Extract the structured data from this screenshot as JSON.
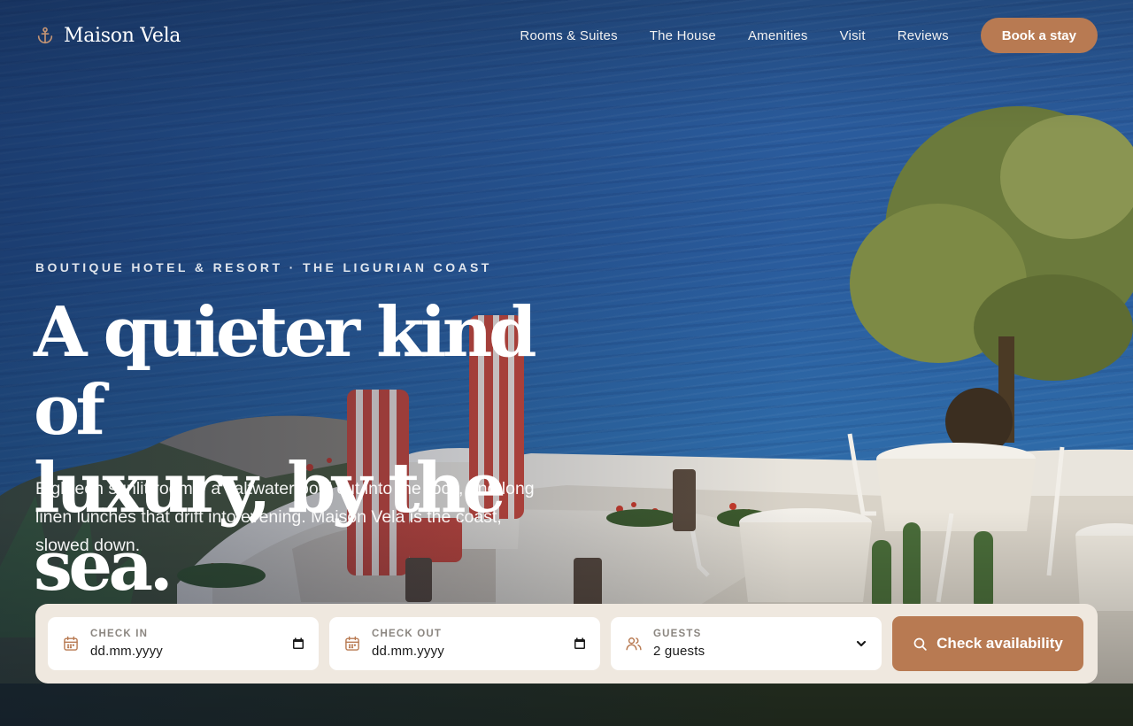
{
  "brand": {
    "name": "Maison Vela",
    "icon": "anchor-icon"
  },
  "nav": {
    "links": [
      "Rooms & Suites",
      "The House",
      "Amenities",
      "Visit",
      "Reviews"
    ],
    "cta": "Book a stay"
  },
  "hero": {
    "eyebrow": "BOUTIQUE HOTEL & RESORT · THE LIGURIAN COAST",
    "headline_line1": "A quieter kind of",
    "headline_line2": "luxury, by the sea.",
    "lede": "Eighteen sunlit rooms, a saltwater pool cut into the rock, and long linen lunches that drift into evening. Maison Vela is the coast, slowed down."
  },
  "booking": {
    "check_in": {
      "label": "CHECK IN",
      "value": "dd.mm.yyyy",
      "icon": "calendar-icon"
    },
    "check_out": {
      "label": "CHECK OUT",
      "value": "dd.mm.yyyy",
      "icon": "calendar-icon"
    },
    "guests": {
      "label": "GUESTS",
      "value": "2 guests",
      "icon": "users-icon"
    },
    "submit": "Check availability"
  },
  "colors": {
    "accent": "#b87a52",
    "booking_bg": "#efe8df",
    "sea": "#2a5c9d"
  }
}
